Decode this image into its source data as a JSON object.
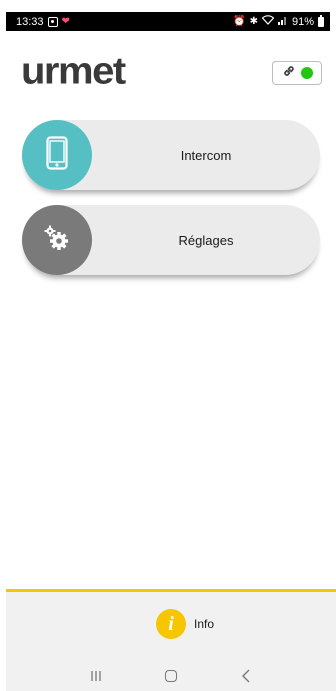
{
  "status_bar": {
    "time": "13:33",
    "battery_percent": "91%",
    "icons": [
      "notification-icon",
      "heart-icon",
      "alarm-icon",
      "bluetooth-icon",
      "wifi-icon",
      "signal-icon",
      "battery-icon"
    ]
  },
  "header": {
    "logo_text": "urmet",
    "connection_status_color": "#22c50f"
  },
  "menu": {
    "items": [
      {
        "label": "Intercom",
        "icon": "smartphone-icon",
        "color": "#56bfc3"
      },
      {
        "label": "Réglages",
        "icon": "gears-icon",
        "color": "#7a7a7a"
      }
    ]
  },
  "footer": {
    "info_label": "Info",
    "accent_color": "#f7c600"
  },
  "nav_bar": {
    "buttons": [
      "recent-apps-icon",
      "home-icon",
      "back-icon"
    ]
  }
}
